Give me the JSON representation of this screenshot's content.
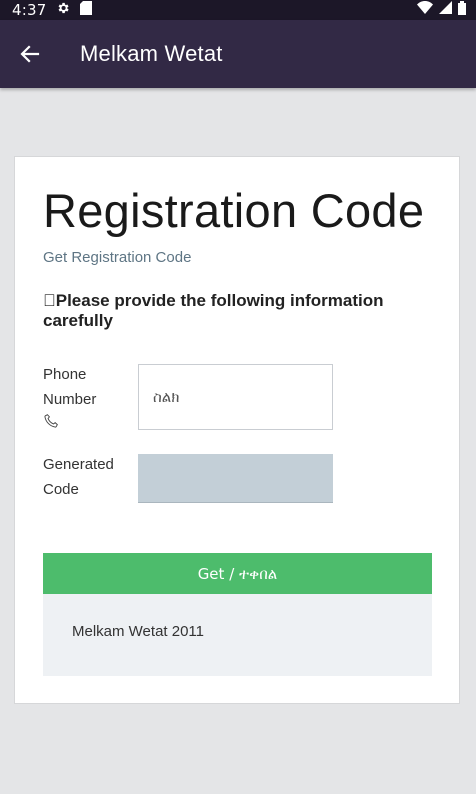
{
  "status_bar": {
    "time": "4:37",
    "icons": [
      "settings-icon",
      "sd-card-icon",
      "wifi-icon",
      "signal-icon",
      "battery-icon"
    ]
  },
  "app_bar": {
    "back_icon": "arrow-left-icon",
    "title": "Melkam Wetat"
  },
  "card": {
    "heading": "Registration Code",
    "sub_link": "Get Registration Code",
    "instruction": "\u0000Please provide the following information carefully",
    "phone": {
      "label": "Phone Number",
      "icon": "phone-icon",
      "placeholder": "ስልክ",
      "value": ""
    },
    "generated_code": {
      "label": "Generated Code",
      "value": ""
    },
    "get_button_label": "Get / ተቀበል",
    "footer_text": "Melkam Wetat 2011"
  },
  "colors": {
    "status_bar": "#1c1728",
    "app_bar": "#322945",
    "background": "#e4e5e7",
    "button": "#4dbc6c",
    "code_field": "#c3cfd7",
    "footer_box": "#eef1f4",
    "link": "#5e7584"
  }
}
